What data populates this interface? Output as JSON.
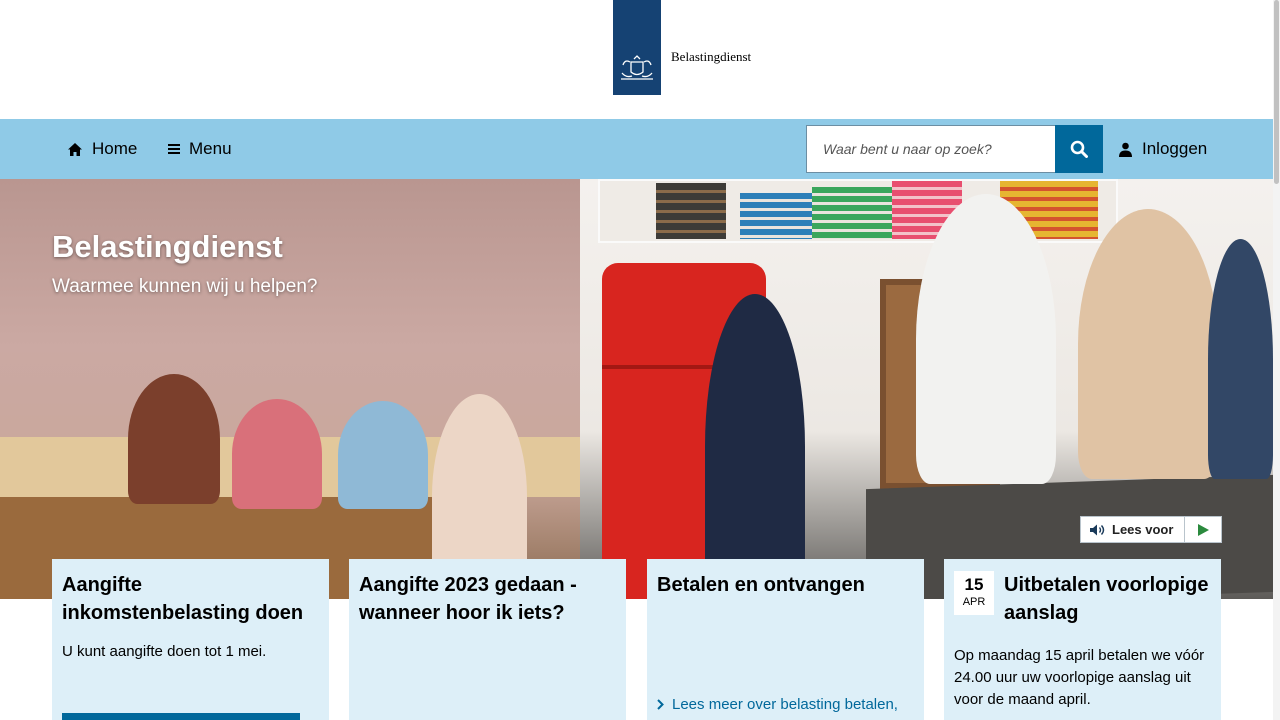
{
  "header": {
    "logo_text": "Belastingdienst"
  },
  "nav": {
    "home_label": "Home",
    "menu_label": "Menu",
    "search_placeholder": "Waar bent u naar op zoek?",
    "login_label": "Inloggen"
  },
  "hero": {
    "title": "Belastingdienst",
    "subtitle": "Waarmee kunnen wij u helpen?"
  },
  "readspeaker": {
    "label": "Lees voor"
  },
  "cards": [
    {
      "title": "Aangifte inkomstenbelasting doen",
      "text": "U kunt aangifte doen tot 1 mei."
    },
    {
      "title": "Aangifte 2023 gedaan - wanneer hoor ik iets?"
    },
    {
      "title": "Betalen en ontvangen",
      "link": "Lees meer over belasting betalen,"
    },
    {
      "date_day": "15",
      "date_month": "APR",
      "title": "Uitbetalen voorlopige aanslag",
      "text": "Op maandag 15 april betalen we vóór 24.00 uur uw voorlopige aanslag uit voor de maand april."
    }
  ],
  "colors": {
    "brand": "#154273",
    "nav_bg": "#8fcae7",
    "accent": "#01689b",
    "card_bg": "#ddeff8"
  }
}
